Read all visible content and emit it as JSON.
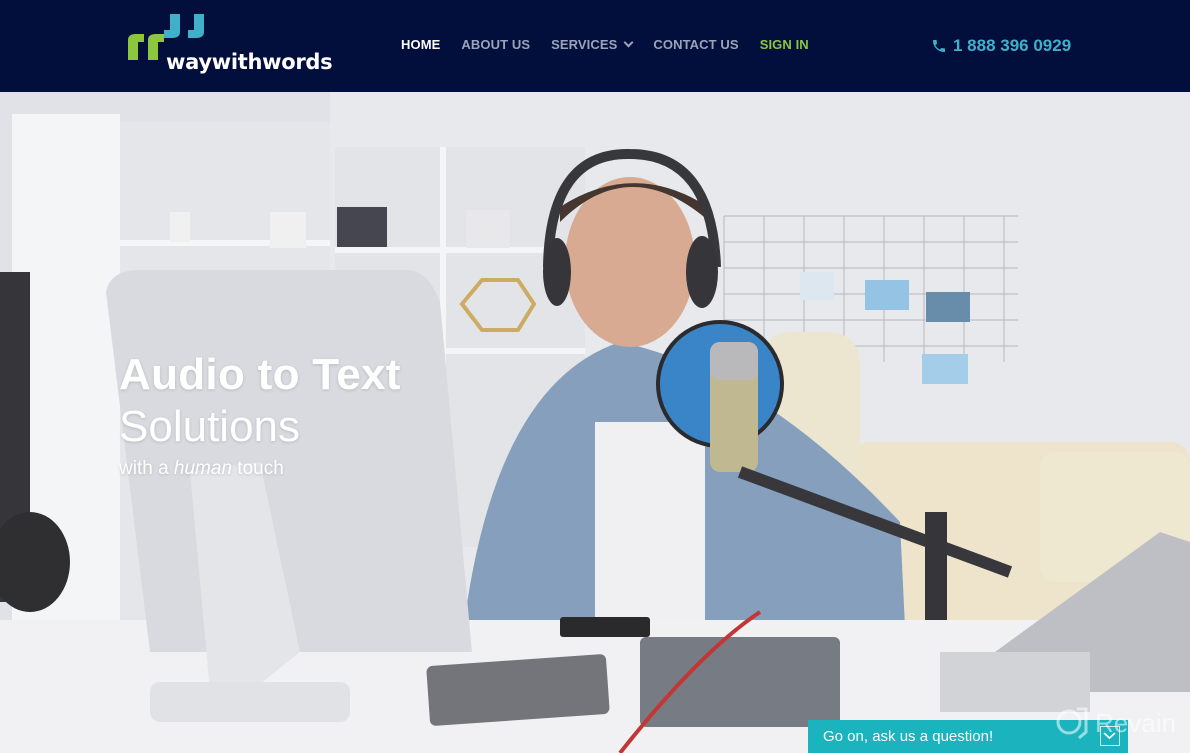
{
  "header": {
    "logo_text": "waywithwords",
    "nav": [
      {
        "label": "HOME",
        "active": true
      },
      {
        "label": "ABOUT US"
      },
      {
        "label": "SERVICES",
        "has_dropdown": true
      },
      {
        "label": "CONTACT US"
      },
      {
        "label": "SIGN IN"
      }
    ],
    "phone_icon": "phone-icon",
    "phone": "1 888 396 0929"
  },
  "hero": {
    "title_line1": "Audio to Text",
    "title_line2": "Solutions",
    "tagline_prefix": "with a ",
    "tagline_emphasis": "human",
    "tagline_suffix": " touch",
    "image_description": "Man wearing headphones recording at a desk with microphone, computer and mixer"
  },
  "chat_widget": {
    "label": "Go on, ask us a question!",
    "toggle_icon": "chevron-down-icon"
  },
  "watermark": {
    "text": "Revain"
  },
  "colors": {
    "header_bg": "#020f3d",
    "accent_green": "#8cc63f",
    "accent_teal": "#3fb0c8",
    "chat_bg": "#1bb3bd"
  }
}
